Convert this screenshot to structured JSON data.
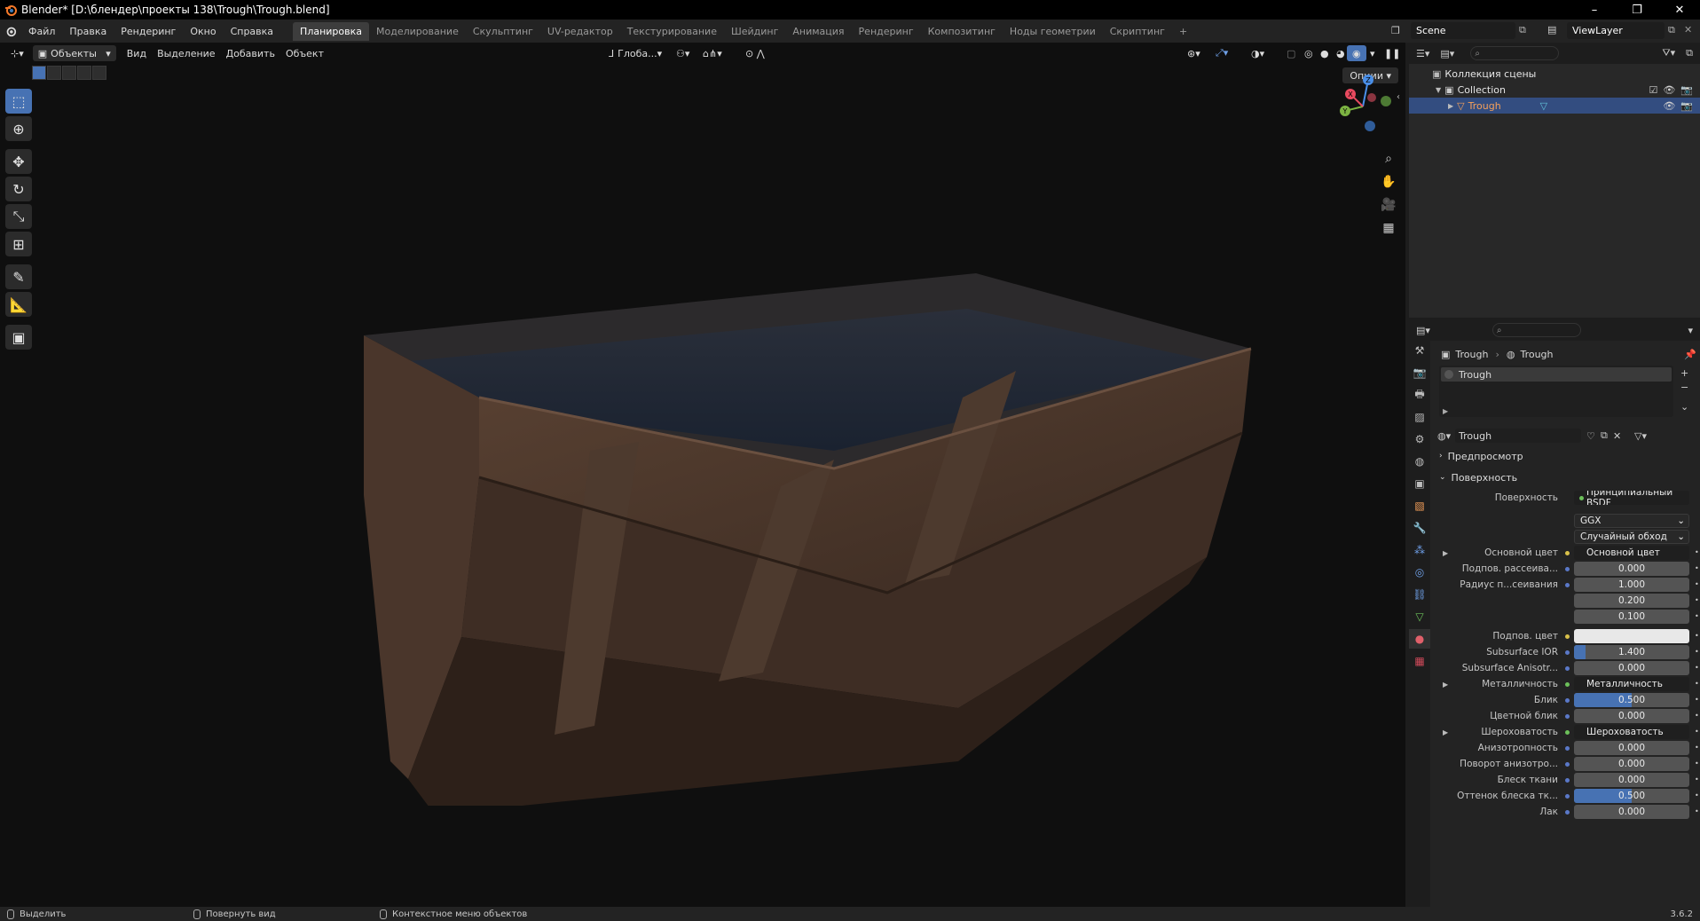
{
  "window": {
    "title": "Blender* [D:\\блендер\\проекты 138\\Trough\\Trough.blend]",
    "controls": [
      "–",
      "❐",
      "✕"
    ]
  },
  "menubar": {
    "menus": [
      "Файл",
      "Правка",
      "Рендеринг",
      "Окно",
      "Справка"
    ],
    "workspaces": [
      "Планировка",
      "Моделирование",
      "Скульптинг",
      "UV-редактор",
      "Текстурирование",
      "Шейдинг",
      "Анимация",
      "Рендеринг",
      "Композитинг",
      "Ноды геометрии",
      "Скриптинг"
    ],
    "active_workspace": "Планировка",
    "add_tab": "+",
    "scene": "Scene",
    "view_layer": "ViewLayer"
  },
  "viewport": {
    "mode": "Объекты",
    "menus": [
      "Вид",
      "Выделение",
      "Добавить",
      "Объект"
    ],
    "orientation": "Глоба...",
    "options_label": "Опции",
    "gizmo_axes": {
      "x": "X",
      "y": "Y",
      "z": "Z"
    },
    "colors": {
      "x": "#e84a5f",
      "y": "#7cb342",
      "z": "#4a8fe8",
      "background": "#0f0f0f"
    }
  },
  "outliner": {
    "root": "Коллекция сцены",
    "collection": "Collection",
    "object": "Trough"
  },
  "properties": {
    "breadcrumb_object": "Trough",
    "breadcrumb_material": "Trough",
    "material_slot": "Trough",
    "material_name": "Trough",
    "panels": {
      "preview": "Предпросмотр",
      "surface": "Поверхность"
    },
    "surface_shader_label": "Поверхность",
    "surface_shader": "Принципиальный BSDF",
    "distribution": "GGX",
    "subsurface_method": "Случайный обход",
    "rows": [
      {
        "label": "Основной цвет",
        "value": "Основной цвет",
        "kind": "link",
        "dot": "yellow",
        "expand": true
      },
      {
        "label": "Подпов. рассеива...",
        "value": "0.000",
        "kind": "num",
        "dot": "blue"
      },
      {
        "label": "Радиус п...сеивания",
        "value": "1.000",
        "kind": "num",
        "dot": "blue"
      },
      {
        "label": "",
        "value": "0.200",
        "kind": "num",
        "dot": "none"
      },
      {
        "label": "",
        "value": "0.100",
        "kind": "num",
        "dot": "none"
      },
      {
        "label": "Подпов. цвет",
        "value": "",
        "kind": "color",
        "dot": "yellow"
      },
      {
        "label": "Subsurface IOR",
        "value": "1.400",
        "kind": "num",
        "dot": "blue",
        "fill": 0.1
      },
      {
        "label": "Subsurface Anisotr...",
        "value": "0.000",
        "kind": "num",
        "dot": "blue"
      },
      {
        "label": "Металличность",
        "value": "Металличность",
        "kind": "link",
        "dot": "green",
        "expand": true
      },
      {
        "label": "Блик",
        "value": "0.500",
        "kind": "num",
        "dot": "blue",
        "fill": 0.5
      },
      {
        "label": "Цветной блик",
        "value": "0.000",
        "kind": "num",
        "dot": "blue"
      },
      {
        "label": "Шероховатость",
        "value": "Шероховатость",
        "kind": "link",
        "dot": "green",
        "expand": true
      },
      {
        "label": "Анизотропность",
        "value": "0.000",
        "kind": "num",
        "dot": "blue"
      },
      {
        "label": "Поворот анизотро...",
        "value": "0.000",
        "kind": "num",
        "dot": "blue"
      },
      {
        "label": "Блеск ткани",
        "value": "0.000",
        "kind": "num",
        "dot": "blue"
      },
      {
        "label": "Оттенок блеска тк...",
        "value": "0.500",
        "kind": "num",
        "dot": "blue",
        "fill": 0.5
      },
      {
        "label": "Лак",
        "value": "0.000",
        "kind": "num",
        "dot": "blue"
      }
    ]
  },
  "statusbar": {
    "select": "Выделить",
    "rotate": "Повернуть вид",
    "context": "Контекстное меню объектов",
    "version": "3.6.2"
  }
}
